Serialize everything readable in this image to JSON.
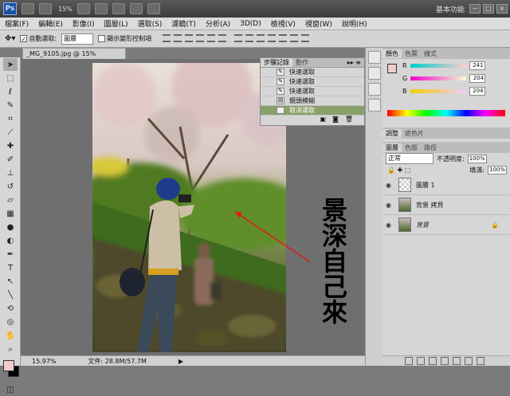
{
  "titlebar": {
    "logo": "Ps",
    "zoom": "15%",
    "workspace": "基本功能",
    "win_buttons": [
      "−",
      "□",
      "×"
    ]
  },
  "menu": [
    "檔案(F)",
    "編輯(E)",
    "影像(I)",
    "圖層(L)",
    "選取(S)",
    "濾鏡(T)",
    "分析(A)",
    "3D(D)",
    "檢視(V)",
    "視窗(W)",
    "說明(H)"
  ],
  "options": {
    "auto_select_label": "自動選取:",
    "auto_select_value": "圖層",
    "transform_label": "顯示變形控制項"
  },
  "document": {
    "tab": "_MG_9105.jpg @ 15% (RGB/8*) *",
    "zoom_status": "15.97%",
    "file_size": "文件: 28.8M/57.7M",
    "overlay_text": "景深自己來"
  },
  "history": {
    "tabs": [
      "步驟記錄",
      "動作"
    ],
    "rows": [
      {
        "label": "快速選取",
        "icon": "quick-select-icon"
      },
      {
        "label": "快速選取",
        "icon": "quick-select-icon"
      },
      {
        "label": "快速選取",
        "icon": "quick-select-icon"
      },
      {
        "label": "鏡頭模糊",
        "icon": "filter-icon"
      },
      {
        "label": "取消選取",
        "icon": "deselect-icon"
      }
    ]
  },
  "color_panel": {
    "tabs": [
      "顏色",
      "色票",
      "樣式"
    ],
    "r": "241",
    "g": "204",
    "b": "204",
    "r_label": "R",
    "g_label": "G",
    "b_label": "B",
    "fg_color": "#f1cccc"
  },
  "adjust_tabs": [
    "調整",
    "遮色片"
  ],
  "layers_panel": {
    "tabs": [
      "圖層",
      "色版",
      "路徑"
    ],
    "blend_mode": "正常",
    "opacity_label": "不透明度:",
    "opacity": "100%",
    "fill_label": "填滿:",
    "fill": "100%",
    "layers": [
      {
        "name": "圖層 1",
        "type": "transparent"
      },
      {
        "name": "背景 拷貝",
        "type": "photo"
      },
      {
        "name": "背景",
        "type": "photo-locked"
      }
    ]
  }
}
